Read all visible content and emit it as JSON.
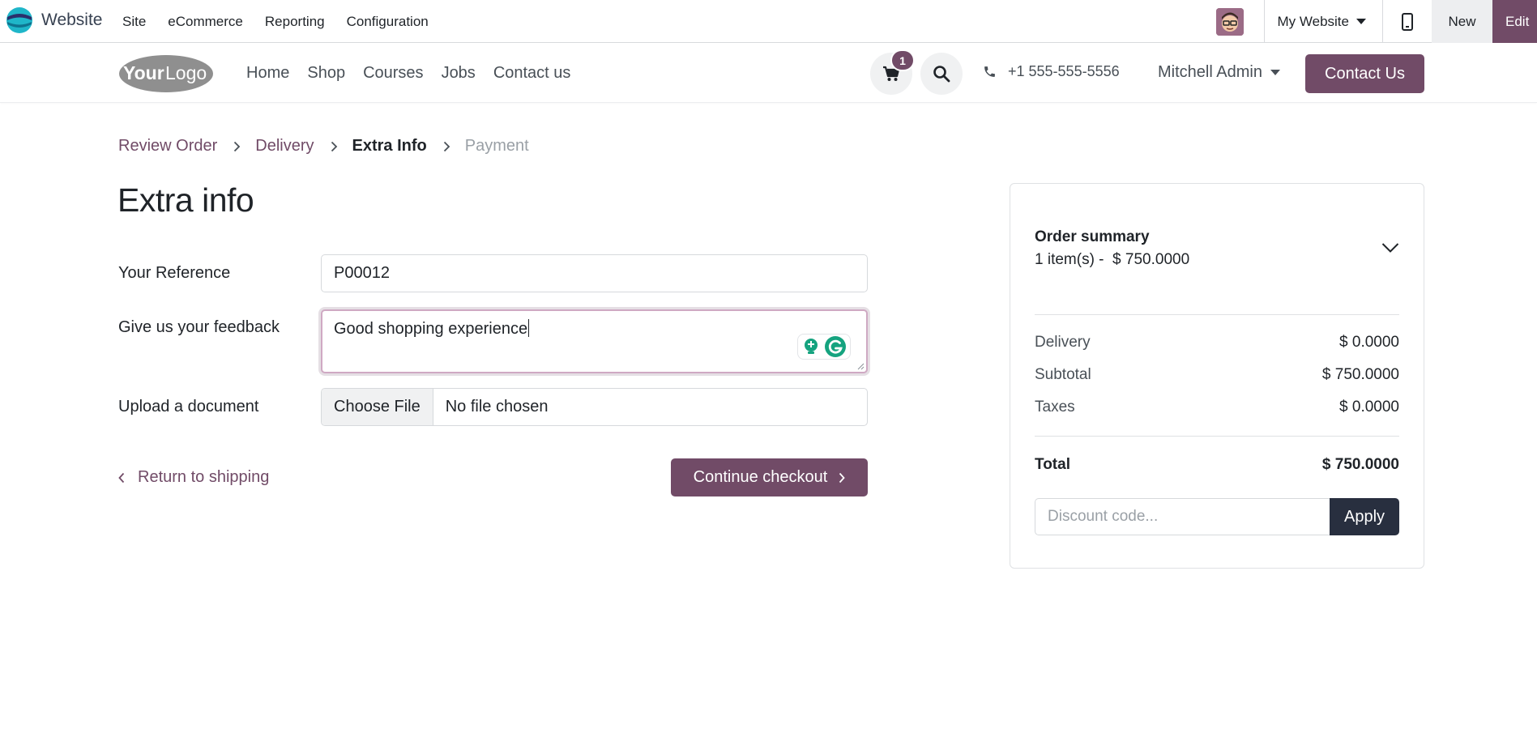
{
  "admin_bar": {
    "app_name": "Website",
    "menu": [
      "Site",
      "eCommerce",
      "Reporting",
      "Configuration"
    ],
    "website_selector": "My Website",
    "new_label": "New",
    "edit_label": "Edit",
    "accent_color": "#714b67"
  },
  "site_header": {
    "nav": [
      "Home",
      "Shop",
      "Courses",
      "Jobs",
      "Contact us"
    ],
    "cart_count": "1",
    "phone": "+1 555-555-5556",
    "user_name": "Mitchell Admin",
    "contact_button": "Contact Us"
  },
  "breadcrumb": {
    "steps": [
      "Review Order",
      "Delivery",
      "Extra Info",
      "Payment"
    ],
    "active_index": 2
  },
  "form": {
    "title": "Extra info",
    "reference_label": "Your Reference",
    "reference_value": "P00012",
    "feedback_label": "Give us your feedback",
    "feedback_value": "Good shopping experience",
    "upload_label": "Upload a document",
    "choose_file_label": "Choose File",
    "file_status": "No file chosen",
    "return_link": "Return to shipping",
    "continue_button": "Continue checkout"
  },
  "order_summary": {
    "title": "Order summary",
    "items_line": "1 item(s) -  $ 750.0000",
    "rows": [
      {
        "label": "Delivery",
        "value": "$ 0.0000"
      },
      {
        "label": "Subtotal",
        "value": "$ 750.0000"
      },
      {
        "label": "Taxes",
        "value": "$ 0.0000"
      }
    ],
    "total_label": "Total",
    "total_value": "$ 750.0000",
    "discount_placeholder": "Discount code...",
    "apply_button": "Apply"
  }
}
